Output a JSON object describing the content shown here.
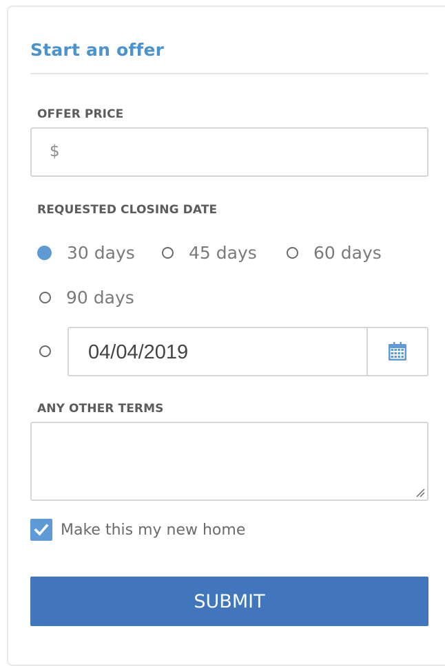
{
  "form": {
    "title": "Start an offer",
    "offer_price": {
      "label": "OFFER PRICE",
      "prefix": "$",
      "value": ""
    },
    "closing_date": {
      "label": "REQUESTED CLOSING DATE",
      "options": [
        {
          "label": "30 days",
          "selected": true
        },
        {
          "label": "45 days",
          "selected": false
        },
        {
          "label": "60 days",
          "selected": false
        },
        {
          "label": "90 days",
          "selected": false
        }
      ],
      "custom_date_value": "04/04/2019",
      "calendar_icon": "calendar-icon"
    },
    "other_terms": {
      "label": "ANY OTHER TERMS",
      "value": ""
    },
    "new_home_checkbox": {
      "label": "Make this my new home",
      "checked": true
    },
    "submit_label": "SUBMIT"
  },
  "colors": {
    "title": "#4a93cf",
    "accent": "#5e9bd6",
    "button": "#4176bd"
  }
}
